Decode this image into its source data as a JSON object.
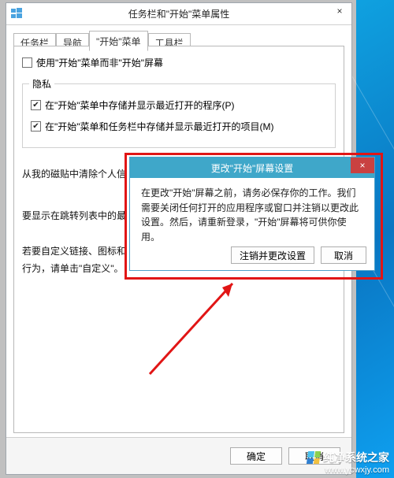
{
  "window": {
    "title": "任务栏和\"开始\"菜单属性",
    "close_glyph": "×",
    "tabs": [
      "任务栏",
      "导航",
      "\"开始\"菜单",
      "工具栏"
    ],
    "active_tab_index": 2,
    "use_start_menu_checkbox": {
      "checked": false,
      "label": "使用\"开始\"菜单而非\"开始\"屏幕"
    },
    "privacy_group": {
      "title": "隐私",
      "items": [
        {
          "checked": true,
          "label": "在\"开始\"菜单中存储并显示最近打开的程序(P)"
        },
        {
          "checked": true,
          "label": "在\"开始\"菜单和任务栏中存储并显示最近打开的项目(M)"
        }
      ]
    },
    "body_lines": [
      "从我的磁贴中清除个人信",
      "要显示在跳转列表中的最",
      "若要自定义链接、图标和",
      "行为，请单击\"自定义\"。"
    ],
    "buttons": {
      "ok": "确定",
      "cancel": "取消"
    }
  },
  "dialog": {
    "title": "更改\"开始\"屏幕设置",
    "close_glyph": "×",
    "body": "在更改\"开始\"屏幕之前，请务必保存你的工作。我们需要关闭任何打开的应用程序或窗口并注销以更改此设置。然后，请重新登录，\"开始\"屏幕将可供你使用。",
    "buttons": {
      "signout": "注销并更改设置",
      "cancel": "取消"
    }
  },
  "watermark": {
    "name": "纯净系统之家",
    "url": "www.ycwxjy.com"
  }
}
